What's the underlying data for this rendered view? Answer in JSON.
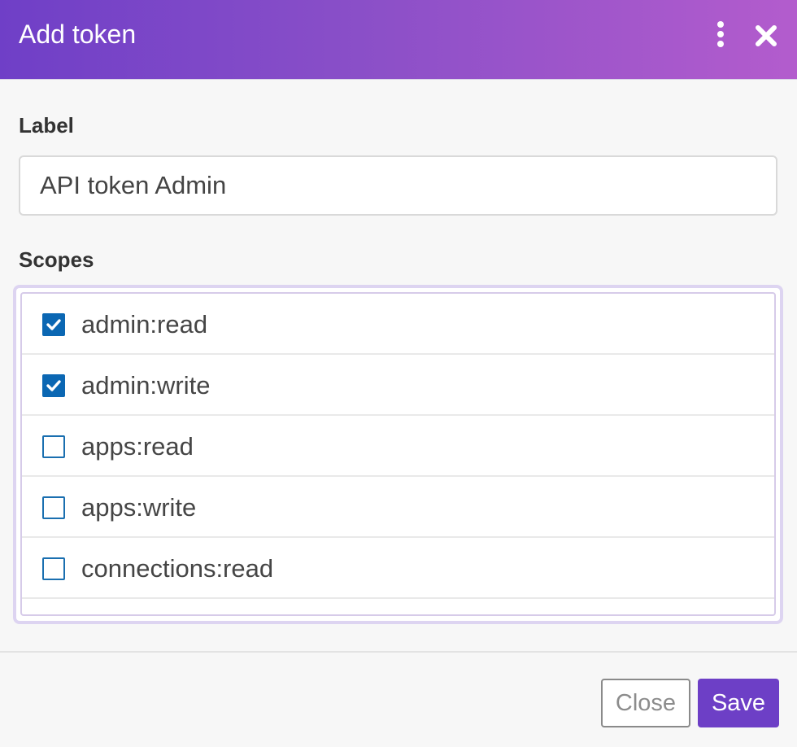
{
  "dialog": {
    "title": "Add token"
  },
  "header": {
    "menu_icon": "more-vertical-icon",
    "close_icon": "close-icon"
  },
  "form": {
    "label_heading": "Label",
    "label_value": "API token Admin",
    "scopes_heading": "Scopes",
    "scopes": [
      {
        "name": "admin:read",
        "checked": true
      },
      {
        "name": "admin:write",
        "checked": true
      },
      {
        "name": "apps:read",
        "checked": false
      },
      {
        "name": "apps:write",
        "checked": false
      },
      {
        "name": "connections:read",
        "checked": false
      }
    ]
  },
  "footer": {
    "close_label": "Close",
    "save_label": "Save"
  },
  "colors": {
    "header_gradient_start": "#6f3fc7",
    "header_gradient_end": "#b35ccd",
    "checkbox_checked": "#0b67b3",
    "save_button": "#6d3fc6"
  }
}
